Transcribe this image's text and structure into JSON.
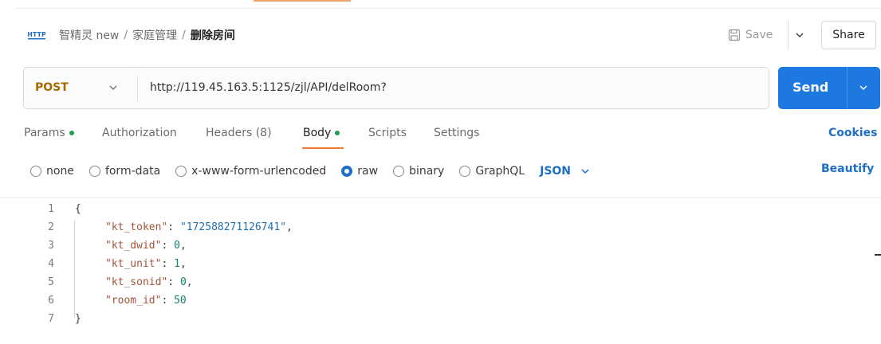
{
  "header": {
    "http_icon": "http-icon",
    "breadcrumb": {
      "workspace": "智精灵 new",
      "folder": "家庭管理",
      "request": "删除房间",
      "separator": "/"
    },
    "save_label": "Save",
    "share_label": "Share"
  },
  "request": {
    "method": "POST",
    "url": "http://119.45.163.5:1125/zjl/API/delRoom?",
    "send_label": "Send"
  },
  "tabs": [
    {
      "label": "Params",
      "dot": true
    },
    {
      "label": "Authorization",
      "dot": false
    },
    {
      "label": "Headers (8)",
      "dot": false
    },
    {
      "label": "Body",
      "dot": true,
      "active": true
    },
    {
      "label": "Scripts",
      "dot": false
    },
    {
      "label": "Settings",
      "dot": false
    }
  ],
  "cookies_label": "Cookies",
  "body_types": [
    {
      "label": "none",
      "checked": false
    },
    {
      "label": "form-data",
      "checked": false
    },
    {
      "label": "x-www-form-urlencoded",
      "checked": false
    },
    {
      "label": "raw",
      "checked": true
    },
    {
      "label": "binary",
      "checked": false
    },
    {
      "label": "GraphQL",
      "checked": false
    }
  ],
  "format_label": "JSON",
  "beautify_label": "Beautify",
  "editor": {
    "line_numbers": [
      "1",
      "2",
      "3",
      "4",
      "5",
      "6",
      "7"
    ],
    "open_brace": "{",
    "close_brace": "}",
    "fields": [
      {
        "key": "\"kt_token\"",
        "value": "\"172588271126741\"",
        "value_type": "string",
        "comma": ","
      },
      {
        "key": "\"kt_dwid\"",
        "value": "0",
        "value_type": "number",
        "comma": ","
      },
      {
        "key": "\"kt_unit\"",
        "value": "1",
        "value_type": "number",
        "comma": ","
      },
      {
        "key": "\"kt_sonid\"",
        "value": "0",
        "value_type": "number",
        "comma": ","
      },
      {
        "key": "\"room_id\"",
        "value": "50",
        "value_type": "number",
        "comma": ""
      }
    ]
  },
  "colors": {
    "send_bg": "#1d78e0",
    "method": "#a86a00",
    "link": "#1d6fc7",
    "tab_active_underline": "#f07a3a",
    "status_dot": "#1e9e4e"
  }
}
